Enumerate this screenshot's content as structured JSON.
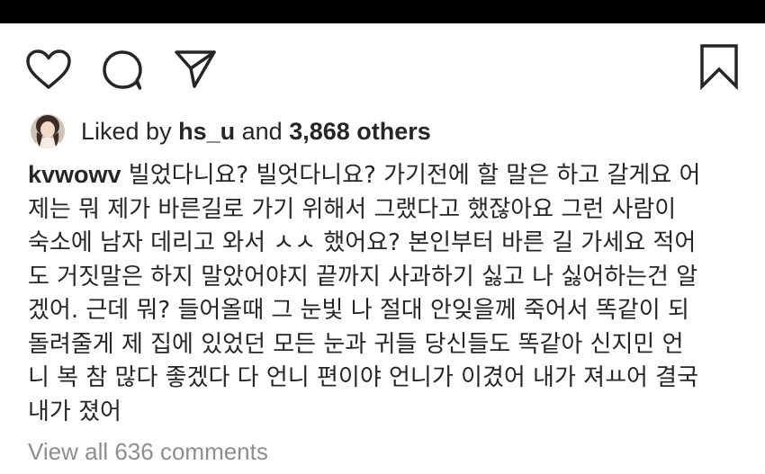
{
  "actions": {
    "like_icon": "heart-outline-icon",
    "comment_icon": "speech-bubble-icon",
    "share_icon": "paper-plane-icon",
    "save_icon": "bookmark-outline-icon"
  },
  "likes": {
    "prefix": "Liked by",
    "user": "hs_u",
    "and": "and",
    "others": "3,868 others"
  },
  "caption": {
    "username": "kvwowv",
    "lines": [
      " 빌었다니요? 빌엇다니요? 가기전에 할 말은 하고 갈게요 어",
      "제는 뭐 제가 바른길로 가기 위해서 그랬다고 했잖아요 그런 사람이",
      "숙소에 남자 데리고 와서 ㅅㅅ 했어요? 본인부터 바른 길 가세요 적어",
      "도 거짓말은 하지 말았어야지 끝까지 사과하기 싫고 나 싫어하는건 알",
      "겠어. 근데 뭐? 들어올때 그 눈빛 나 절대 안잊을께 죽어서 똑같이 되",
      "돌려줄게 제 집에 있었던 모든 눈과 귀들 당신들도 똑같아 신지민 언",
      "니 복 참 많다 좋겠다 다 언니 편이야 언니가 이겼어 내가 져ㅛ어 결국",
      "내가 졌어"
    ]
  },
  "comments": {
    "view_all": "View all 636 comments"
  }
}
